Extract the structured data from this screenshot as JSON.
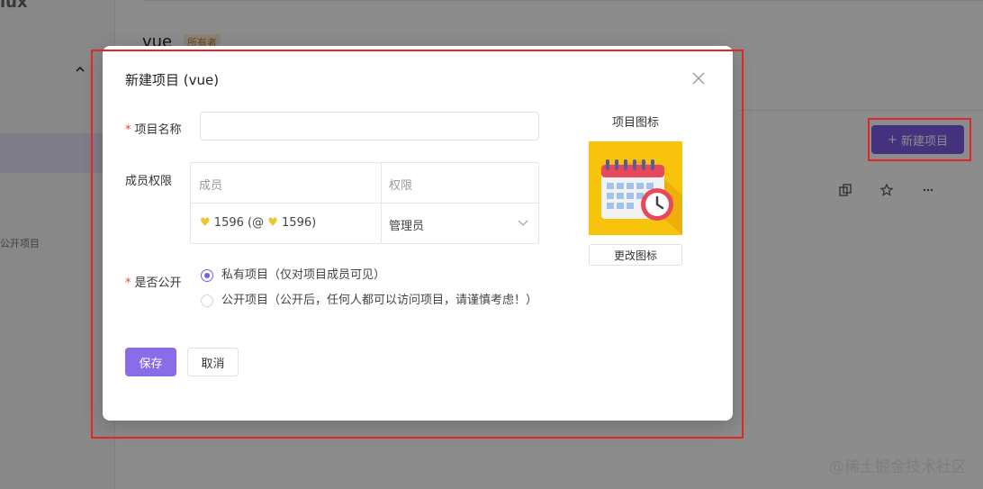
{
  "background": {
    "logo_text": "lux",
    "sidebar_text": "公开项目",
    "project_title": "vue",
    "owner_badge": "所有者",
    "new_project_button": "新建项目",
    "watermark": "@稀土掘金技术社区"
  },
  "modal": {
    "title": "新建项目 (vue)",
    "name_label": "项目名称",
    "name_value": "",
    "members_label": "成员权限",
    "table": {
      "headers": [
        "成员",
        "权限"
      ],
      "rows": [
        {
          "member": "1596 (@",
          "member_suffix": "1596)",
          "role": "管理员"
        }
      ]
    },
    "visibility_label": "是否公开",
    "options": {
      "private": "私有项目（仅对项目成员可见）",
      "public": "公开项目（公开后，任何人都可以访问项目，请谨慎考虑！）"
    },
    "selected_option": "private",
    "save_button": "保存",
    "cancel_button": "取消",
    "icon_label": "项目图标",
    "change_icon_button": "更改图标"
  },
  "colors": {
    "accent": "#7c5ce6",
    "highlight": "#e02727",
    "required": "#e54545",
    "icon_bg": "#f7c30c"
  }
}
